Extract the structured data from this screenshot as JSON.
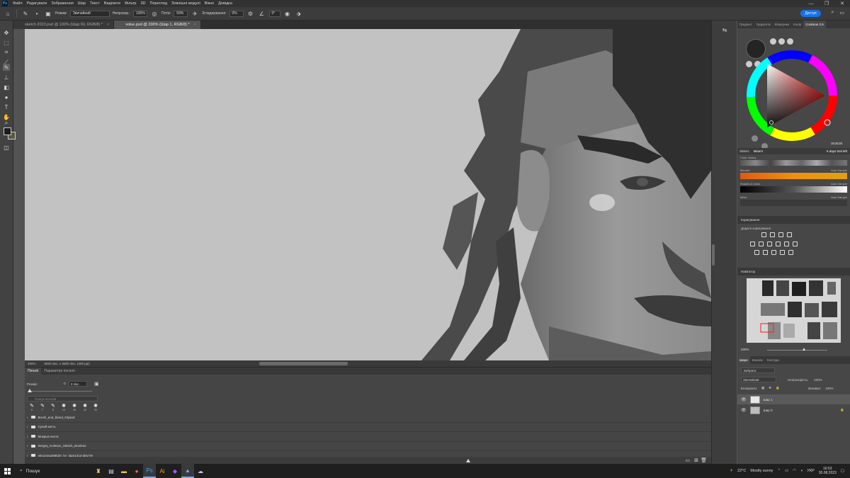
{
  "menu": [
    "Файл",
    "Редагувати",
    "Зображення",
    "Шар",
    "Текст",
    "Виділити",
    "Фільтр",
    "3D",
    "Перегляд",
    "Зовнішні модулі",
    "Вікно",
    "Довідка"
  ],
  "window_controls": [
    "—",
    "❐",
    "✕"
  ],
  "options": {
    "mode_label": "Режим:",
    "mode_value": "Звичайний",
    "opacity_label": "Непрозор.:",
    "opacity_value": "100%",
    "flow_label": "Потік:",
    "flow_value": "59%",
    "smoothing_label": "Згладжування:",
    "smoothing_value": "0%",
    "angle_value": "0°",
    "share_label": "Доступ"
  },
  "doc_tabs": [
    {
      "label": "sketch 2023.psd @ 100% (Шар 60, RGB/8) *",
      "active": false
    },
    {
      "label": "volue.psd @ 200% (Шар 1, RGB/8) *",
      "active": true
    }
  ],
  "status": {
    "zoom": "200%",
    "doc_size": "5000 пікс. x 3500 пікс. (300 ppi)"
  },
  "brush_panel": {
    "tabs": [
      "Пензлі",
      "Параметри пензля"
    ],
    "size_label": "Розмір:",
    "size_value": "9 пікс.",
    "search_placeholder": "Пошук пензлів",
    "recent_sizes": [
      "8",
      "7",
      "8",
      "10",
      "40",
      "40",
      "30"
    ],
    "folders": [
      "Brush_and_bland_Olyand",
      "Сухий кисть",
      "Мокрые кисти",
      "Sergey_Kolesov_Sketch_Brushes",
      "mkuzana258520_by_tigar1313-d8u7r9"
    ]
  },
  "right_panel": {
    "top_tabs": [
      "Градієнт",
      "Градієнти",
      "Візерунки",
      "Колір",
      "Coolorus 2.5"
    ],
    "hex": "3E3E3E",
    "sub_tabs": [
      "Sliders",
      "Mixers"
    ],
    "trial": "5 days trial left",
    "strips": [
      {
        "label": "Color history",
        "auto": ""
      },
      {
        "label": "Blender",
        "auto": "Auto Sample"
      },
      {
        "label": "Shades & tones",
        "auto": "Auto Sample"
      },
      {
        "label": "Mixer",
        "auto": "Auto Sample"
      }
    ],
    "adjustments_title": "Коригування",
    "adjustments_sub": "Додати коригування",
    "navigator_title": "Навігатор",
    "navigator_zoom": "200%",
    "layers_tabs": [
      "Шари",
      "Канали",
      "Контури"
    ],
    "layers_search": "Вибрати",
    "blend_mode": "Звичайний",
    "opacity_label": "Непрозорість:",
    "opacity_value": "100%",
    "lock_label": "Блокувати:",
    "fill_label": "Заливка:",
    "fill_value": "100%",
    "layers": [
      {
        "name": "Шар 1",
        "selected": true
      },
      {
        "name": "Шар 0",
        "selected": false
      }
    ]
  },
  "taskbar": {
    "search": "Пошук",
    "weather_temp": "22°C",
    "weather_text": "Mostly sunny",
    "lang": "УКР",
    "time": "16:53",
    "date": "30.08.2023"
  },
  "colors": {
    "accent": "#1473e6",
    "canvas_bg": "#c2c2c2",
    "fg": "#242424",
    "bg": "#5a5840"
  }
}
